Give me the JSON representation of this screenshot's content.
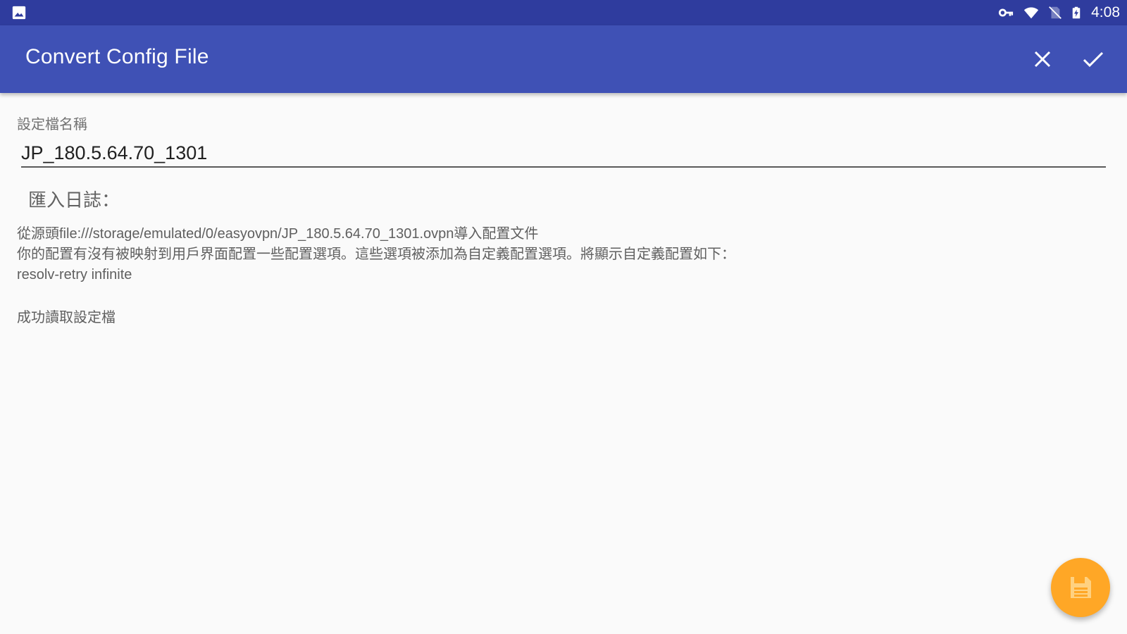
{
  "status_bar": {
    "left_icon": "image-notification-icon",
    "icons": [
      "vpn-key-icon",
      "wifi-icon",
      "no-sim-icon",
      "battery-charging-icon"
    ],
    "time": "4:08",
    "background": "#2f3c9e"
  },
  "app_bar": {
    "title": "Convert Config File",
    "close_icon": "close-icon",
    "confirm_icon": "check-icon",
    "background": "#3f51b5"
  },
  "form": {
    "name_label": "設定檔名稱",
    "name_value": "JP_180.5.64.70_1301"
  },
  "log": {
    "heading": "匯入日誌：",
    "lines": [
      "從源頭file:///storage/emulated/0/easyovpn/JP_180.5.64.70_1301.ovpn導入配置文件",
      "你的配置有沒有被映射到用戶界面配置一些配置選項。這些選項被添加為自定義配置選項。將顯示自定義配置如下：",
      "resolv-retry infinite"
    ],
    "success": "成功讀取設定檔"
  },
  "fab": {
    "icon": "save-file-icon",
    "color": "#ffa726"
  }
}
